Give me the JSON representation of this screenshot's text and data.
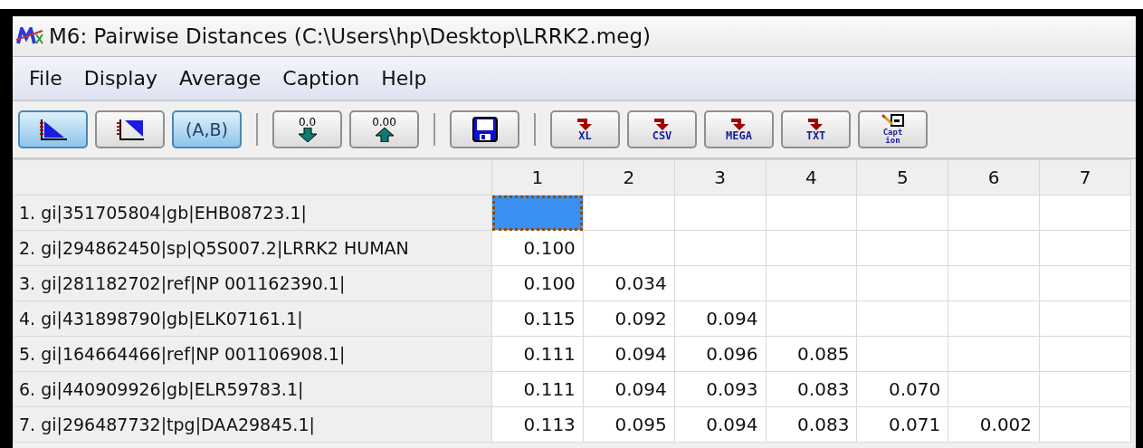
{
  "window": {
    "title": "M6: Pairwise Distances (C:\\Users\\hp\\Desktop\\LRRK2.meg)"
  },
  "menu": [
    "File",
    "Display",
    "Average",
    "Caption",
    "Help"
  ],
  "toolbar": [
    {
      "kind": "lower",
      "selected": true
    },
    {
      "kind": "upper",
      "selected": false
    },
    {
      "kind": "text",
      "label": "(A,B)",
      "selected": true
    },
    {
      "kind": "separator"
    },
    {
      "kind": "decimals_down",
      "label": "0.0",
      "selected": false
    },
    {
      "kind": "decimals_up",
      "label": "0.00",
      "selected": false
    },
    {
      "kind": "separator"
    },
    {
      "kind": "save",
      "selected": false
    },
    {
      "kind": "separator"
    },
    {
      "kind": "export",
      "label": "XL",
      "selected": false
    },
    {
      "kind": "export",
      "label": "CSV",
      "selected": false
    },
    {
      "kind": "export",
      "label": "MEGA",
      "selected": false
    },
    {
      "kind": "export",
      "label": "TXT",
      "selected": false
    },
    {
      "kind": "caption",
      "lines": [
        "Capt",
        "ion"
      ],
      "selected": false
    }
  ],
  "table": {
    "columns": [
      "1",
      "2",
      "3",
      "4",
      "5",
      "6",
      "7"
    ],
    "rows": [
      {
        "label": "1. gi|351705804|gb|EHB08723.1|",
        "cells": [
          {
            "selected": true
          }
        ]
      },
      {
        "label": "2. gi|294862450|sp|Q5S007.2|LRRK2 HUMAN",
        "cells": [
          {
            "value": "0.100",
            "selected": false
          }
        ]
      },
      {
        "label": "3. gi|281182702|ref|NP 001162390.1|",
        "cells": [
          {
            "value": "0.100",
            "selected": false
          },
          {
            "value": "0.034",
            "selected": false
          }
        ]
      },
      {
        "label": "4. gi|431898790|gb|ELK07161.1|",
        "cells": [
          {
            "value": "0.115",
            "selected": false
          },
          {
            "value": "0.092",
            "selected": false
          },
          {
            "value": "0.094",
            "selected": false
          }
        ]
      },
      {
        "label": "5. gi|164664466|ref|NP 001106908.1|",
        "cells": [
          {
            "value": "0.111",
            "selected": false
          },
          {
            "value": "0.094",
            "selected": false
          },
          {
            "value": "0.096",
            "selected": false
          },
          {
            "value": "0.085",
            "selected": false
          }
        ]
      },
      {
        "label": "6. gi|440909926|gb|ELR59783.1|",
        "cells": [
          {
            "value": "0.111",
            "selected": false
          },
          {
            "value": "0.094",
            "selected": false
          },
          {
            "value": "0.093",
            "selected": false
          },
          {
            "value": "0.083",
            "selected": false
          },
          {
            "value": "0.070",
            "selected": false
          }
        ]
      },
      {
        "label": "7. gi|296487732|tpg|DAA29845.1|",
        "cells": [
          {
            "value": "0.113",
            "selected": false
          },
          {
            "value": "0.095",
            "selected": false
          },
          {
            "value": "0.094",
            "selected": false
          },
          {
            "value": "0.083",
            "selected": false
          },
          {
            "value": "0.071",
            "selected": false
          },
          {
            "value": "0.002",
            "selected": false
          }
        ]
      }
    ]
  }
}
